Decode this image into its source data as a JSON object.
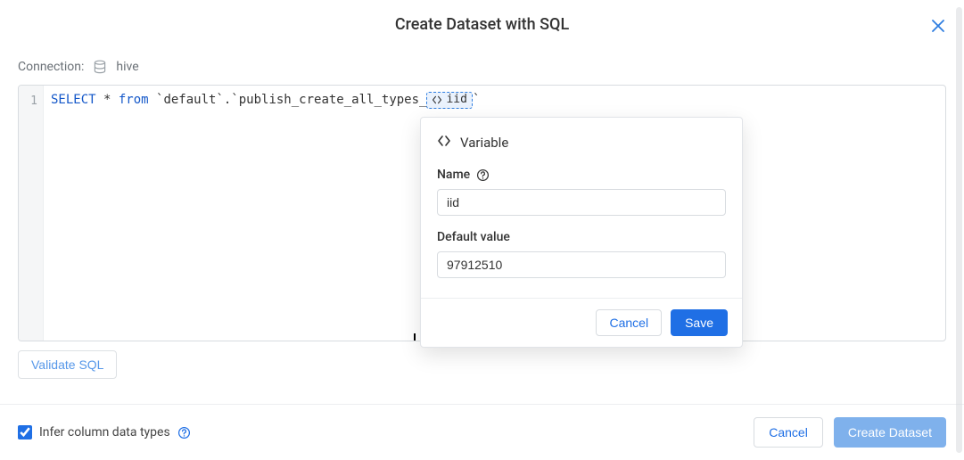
{
  "header": {
    "title": "Create Dataset with SQL"
  },
  "connection": {
    "label": "Connection:",
    "value": "hive"
  },
  "editor": {
    "line_numbers": [
      "1"
    ],
    "tokens": {
      "kw1": "SELECT",
      "star": " * ",
      "kw2": "from",
      "tbl_prefix": " `default`.`publish_create_all_types_",
      "var_chip_text": "iid",
      "tbl_suffix": "`"
    }
  },
  "validate": {
    "label": "Validate SQL"
  },
  "footer": {
    "infer_label": "Infer column data types",
    "infer_checked": true,
    "cancel": "Cancel",
    "create": "Create Dataset"
  },
  "variable_popover": {
    "title": "Variable",
    "name_label": "Name",
    "name_value": "iid",
    "default_label": "Default value",
    "default_value": "97912510",
    "cancel": "Cancel",
    "save": "Save"
  }
}
